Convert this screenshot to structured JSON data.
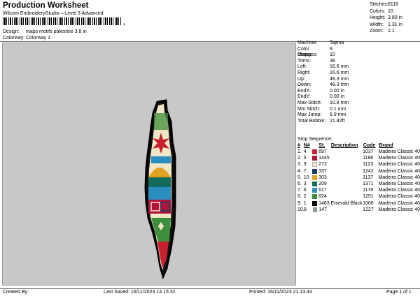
{
  "header": {
    "title": "Production Worksheet",
    "subtitle": "Wilcom EmbroideryStudio – Level 3 Advanced",
    "barcode_tail": ","
  },
  "design_info": [
    {
      "label": "Design:",
      "value": "maps motifs palestine 3,8 in"
    },
    {
      "label": "Colorway:",
      "value": "Colorway 1"
    }
  ],
  "stats": [
    {
      "label": "Stitches:",
      "value": "6116"
    },
    {
      "label": "Colors:",
      "value": "10"
    },
    {
      "label": "Height:",
      "value": "3.80 in"
    },
    {
      "label": "Width:",
      "value": "1.31 in"
    },
    {
      "label": "Zoom:",
      "value": "1:1"
    }
  ],
  "machine_props": [
    {
      "label": "Machine:",
      "value": "Tajima"
    },
    {
      "label": "Color changes:",
      "value": "9"
    },
    {
      "label": "Stops:",
      "value": "10"
    },
    {
      "label": "Trims:",
      "value": "38"
    },
    {
      "label": "Left:",
      "value": "16.6 mm"
    },
    {
      "label": "Right:",
      "value": "16.6 mm"
    },
    {
      "label": "Up:",
      "value": "48.3 mm"
    },
    {
      "label": "Down:",
      "value": "48.3 mm"
    },
    {
      "label": "EndX:",
      "value": "0.00 in"
    },
    {
      "label": "EndY:",
      "value": "0.00 in"
    },
    {
      "label": "Max Stitch:",
      "value": "10.8 mm"
    },
    {
      "label": "Min Stitch:",
      "value": "0.1 mm"
    },
    {
      "label": "Max Jump:",
      "value": "6.9 mm"
    },
    {
      "label": "Total Bobbin:",
      "value": "21.82ft"
    }
  ],
  "stop_sequence": {
    "title": "Stop Sequence:",
    "headers": {
      "stop": "#",
      "n": "N#",
      "st": "St.",
      "desc": "Description",
      "code": "Code",
      "brand": "Brand"
    },
    "rows": [
      {
        "stop": "1.",
        "n": "4",
        "color": "#c8202e",
        "st": "697",
        "desc": "",
        "code": "1037",
        "brand": "Madeira Classic 40"
      },
      {
        "stop": "2.",
        "n": "5",
        "color": "#b3123a",
        "st": "1445",
        "desc": "",
        "code": "1186",
        "brand": "Madeira Classic 40"
      },
      {
        "stop": "3.",
        "n": "9",
        "color": "#f1e7c8",
        "st": "272",
        "desc": "",
        "code": "1123",
        "brand": "Madeira Classic 40"
      },
      {
        "stop": "4.",
        "n": "7",
        "color": "#1b3c6b",
        "st": "337",
        "desc": "",
        "code": "1242",
        "brand": "Madeira Classic 40"
      },
      {
        "stop": "5.",
        "n": "10",
        "color": "#e0a321",
        "st": "303",
        "desc": "",
        "code": "1137",
        "brand": "Madeira Classic 40"
      },
      {
        "stop": "6.",
        "n": "3",
        "color": "#146b5a",
        "st": "209",
        "desc": "",
        "code": "1371",
        "brand": "Madeira Classic 40"
      },
      {
        "stop": "7.",
        "n": "6",
        "color": "#2b8ec0",
        "st": "617",
        "desc": "",
        "code": "1176",
        "brand": "Madeira Classic 40"
      },
      {
        "stop": "8.",
        "n": "2",
        "color": "#3d8e3a",
        "st": "824",
        "desc": "",
        "code": "1251",
        "brand": "Madeira Classic 40"
      },
      {
        "stop": "9.",
        "n": "1",
        "color": "#000000",
        "st": "1463",
        "desc": "Emerald Black",
        "code": "1000",
        "brand": "Madeira Classic 40"
      },
      {
        "stop": "10.",
        "n": "8",
        "color": "#8a9e94",
        "st": "147",
        "desc": "",
        "code": "1227",
        "brand": "Madeira Classic 40"
      }
    ]
  },
  "footer": {
    "created_by": "Created By:",
    "last_saved": "Last Saved: 16/11/2023 13.15.32",
    "printed": "Printed: 16/11/2023 21.13.44",
    "page": "Page 1 of 1"
  }
}
